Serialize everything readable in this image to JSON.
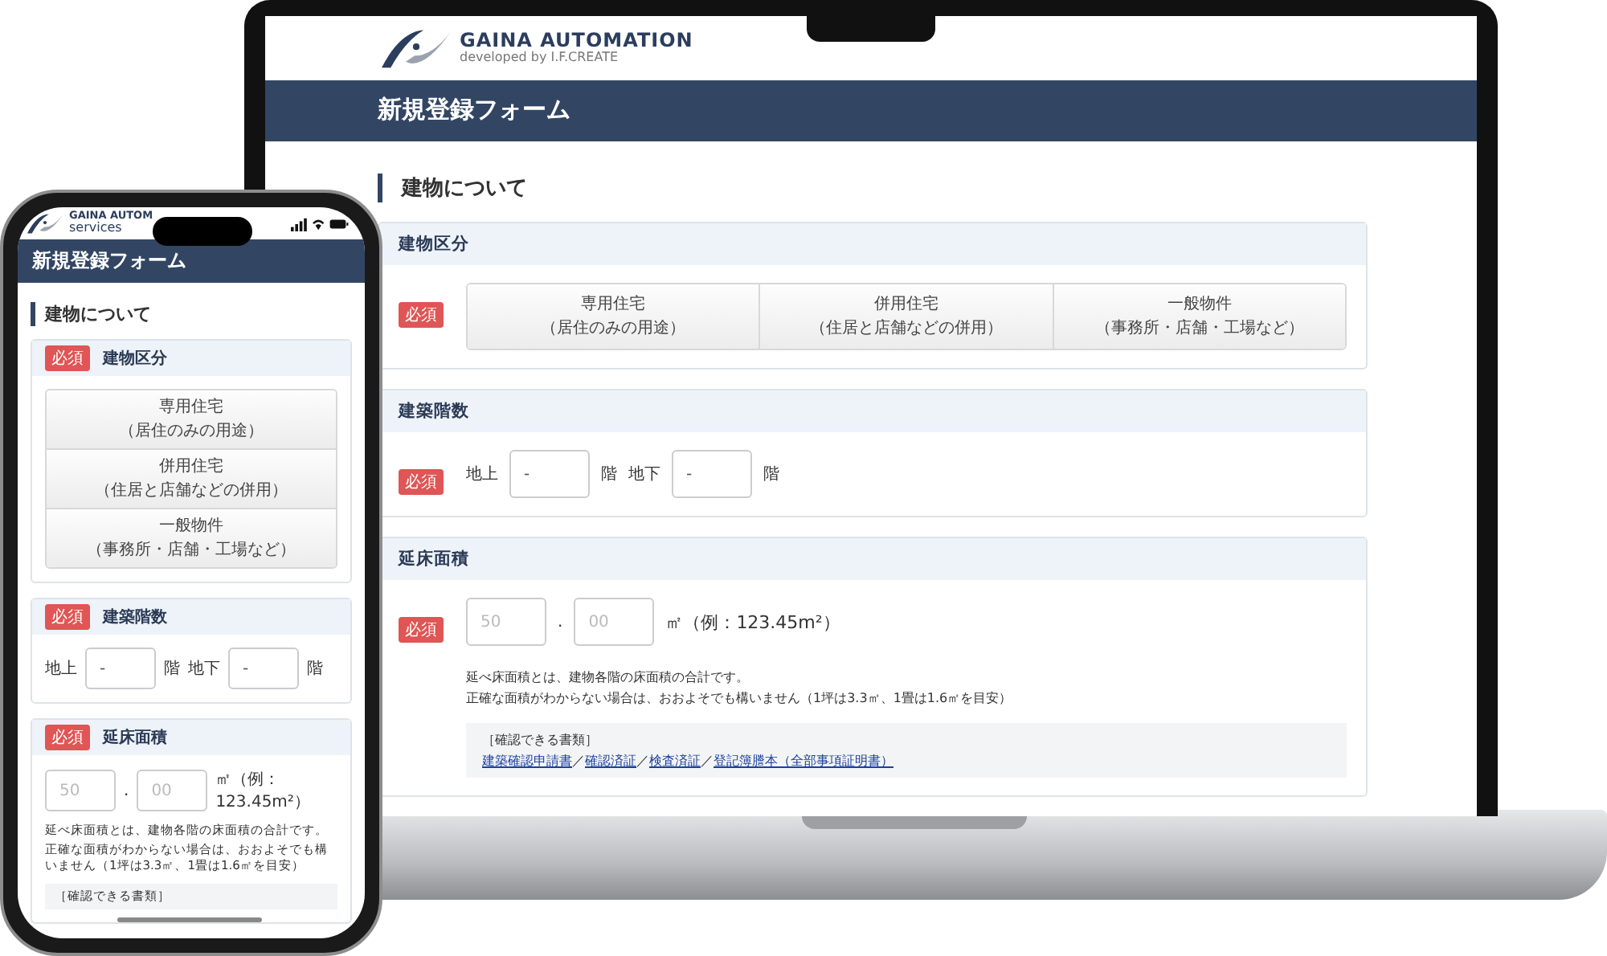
{
  "devices": [
    {
      "kind": "laptop",
      "logo": {
        "name": "GAINA AUTOMATION",
        "tagline": "developed by I.F.CREATE"
      },
      "header_title": "新規登録フォーム",
      "section_title": "建物について",
      "fields": [
        {
          "kind": "choice",
          "label": "建物区分",
          "required": "必須",
          "options": [
            {
              "title": "専用住宅",
              "note": "（居住のみの用途）"
            },
            {
              "title": "併用住宅",
              "note": "（住居と店舗などの併用）"
            },
            {
              "title": "一般物件",
              "note": "（事務所・店舗・工場など）"
            }
          ]
        },
        {
          "kind": "floors",
          "label": "建築階数",
          "required": "必須",
          "above_label": "地上",
          "above_value": "-",
          "above_unit": "階",
          "below_label": "地下",
          "below_value": "-",
          "below_unit": "階"
        },
        {
          "kind": "area",
          "label": "延床面積",
          "required": "必須",
          "int_placeholder": "50",
          "separator": ".",
          "dec_placeholder": "00",
          "unit": "㎡（例：123.45m²）",
          "notes": [
            "延べ床面積とは、建物各階の床面積の合計です。",
            "正確な面積がわからない場合は、おおよそでも構いません（1坪は3.3㎡、1畳は1.6㎡を目安）"
          ],
          "docs_heading": "［確認できる書類］",
          "doc_links": [
            "建築確認申請書",
            "確認済証",
            "検査済証",
            "登記簿謄本（全部事項証明書）"
          ],
          "link_separator": "／"
        }
      ]
    },
    {
      "kind": "phone",
      "logo": {
        "name": "GAINA AUTOM",
        "tagline": "services"
      },
      "header_title": "新規登録フォーム",
      "section_title": "建物について",
      "fields": [
        {
          "kind": "choice",
          "label": "建物区分",
          "required": "必須",
          "options": [
            {
              "title": "専用住宅",
              "note": "（居住のみの用途）"
            },
            {
              "title": "併用住宅",
              "note": "（住居と店舗などの併用）"
            },
            {
              "title": "一般物件",
              "note": "（事務所・店舗・工場など）"
            }
          ]
        },
        {
          "kind": "floors",
          "label": "建築階数",
          "required": "必須",
          "above_label": "地上",
          "above_value": "-",
          "above_unit": "階",
          "below_label": "地下",
          "below_value": "-",
          "below_unit": "階"
        },
        {
          "kind": "area",
          "label": "延床面積",
          "required": "必須",
          "int_placeholder": "50",
          "separator": ".",
          "dec_placeholder": "00",
          "unit": "㎡（例：123.45m²）",
          "notes": [
            "延べ床面積とは、建物各階の床面積の合計です。",
            "正確な面積がわからない場合は、おおよそでも構いません（1坪は3.3㎡、1畳は1.6㎡を目安）"
          ],
          "docs_heading": "［確認できる書類］"
        }
      ]
    }
  ]
}
